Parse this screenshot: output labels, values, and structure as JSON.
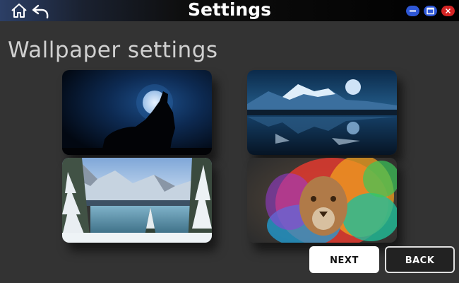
{
  "window": {
    "title": "Settings",
    "controls": {
      "minimize_color": "#2e57d6",
      "maximize_color": "#2e57d6",
      "close_color": "#d42424"
    }
  },
  "nav": {
    "home_icon": "home-icon",
    "back_icon": "undo-arrow-icon"
  },
  "page": {
    "heading": "Wallpaper settings"
  },
  "wallpapers": [
    {
      "name": "wolf-howling-moon"
    },
    {
      "name": "moonlit-mountain-lake"
    },
    {
      "name": "snowy-mountain-lake"
    },
    {
      "name": "colorful-lion"
    }
  ],
  "actions": {
    "next_label": "NEXT",
    "back_label": "BACK"
  }
}
